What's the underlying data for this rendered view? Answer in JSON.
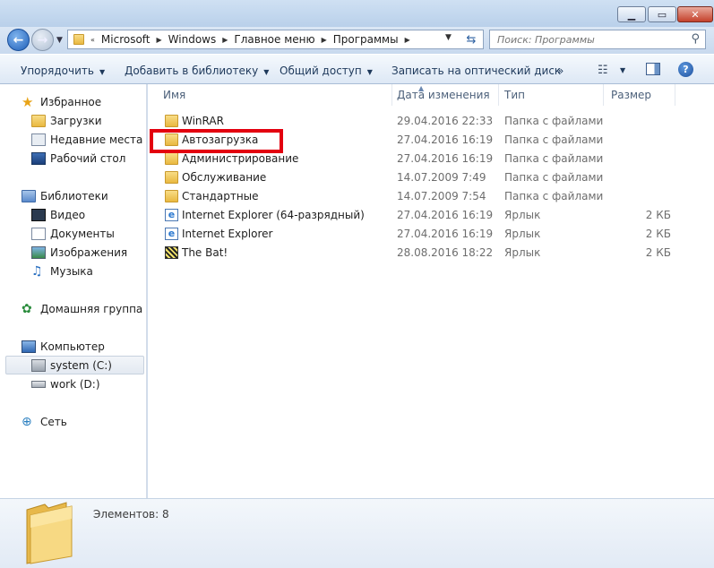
{
  "window": {
    "min_icon": "minimize-icon",
    "max_icon": "maximize-icon",
    "close_icon": "close-icon"
  },
  "nav": {
    "breadcrumb_overflow": "«",
    "breadcrumb": [
      "Microsoft",
      "Windows",
      "Главное меню",
      "Программы"
    ],
    "search_placeholder": "Поиск: Программы"
  },
  "toolbar": {
    "organize": "Упорядочить",
    "add_library": "Добавить в библиотеку",
    "share": "Общий доступ",
    "burn": "Записать на оптический диск",
    "more": "»"
  },
  "sidebar": {
    "favorites": "Избранное",
    "downloads": "Загрузки",
    "recent": "Недавние места",
    "desktop": "Рабочий стол",
    "libraries": "Библиотеки",
    "video": "Видео",
    "documents": "Документы",
    "images": "Изображения",
    "music": "Музыка",
    "homegroup": "Домашняя группа",
    "computer": "Компьютер",
    "drive_c": "system (C:)",
    "drive_d": "work (D:)",
    "network": "Сеть"
  },
  "columns": {
    "name": "Имя",
    "date": "Дата изменения",
    "type": "Тип",
    "size": "Размер"
  },
  "files": [
    {
      "name": "WinRAR",
      "date": "29.04.2016 22:33",
      "type": "Папка с файлами",
      "size": "",
      "icon": "folder-icon"
    },
    {
      "name": "Автозагрузка",
      "date": "27.04.2016 16:19",
      "type": "Папка с файлами",
      "size": "",
      "icon": "folder-icon"
    },
    {
      "name": "Администрирование",
      "date": "27.04.2016 16:19",
      "type": "Папка с файлами",
      "size": "",
      "icon": "folder-icon"
    },
    {
      "name": "Обслуживание",
      "date": "14.07.2009 7:49",
      "type": "Папка с файлами",
      "size": "",
      "icon": "folder-icon"
    },
    {
      "name": "Стандартные",
      "date": "14.07.2009 7:54",
      "type": "Папка с файлами",
      "size": "",
      "icon": "folder-icon"
    },
    {
      "name": "Internet Explorer (64-разрядный)",
      "date": "27.04.2016 16:19",
      "type": "Ярлык",
      "size": "2 КБ",
      "icon": "internet-explorer-shortcut-icon"
    },
    {
      "name": "Internet Explorer",
      "date": "27.04.2016 16:19",
      "type": "Ярлык",
      "size": "2 КБ",
      "icon": "internet-explorer-shortcut-icon"
    },
    {
      "name": "The Bat!",
      "date": "28.08.2016 18:22",
      "type": "Ярлык",
      "size": "2 КБ",
      "icon": "the-bat-shortcut-icon"
    }
  ],
  "details": {
    "count": "Элементов: 8"
  },
  "colors": {
    "highlight": "#e3000f",
    "toolbar_text": "#1e395b"
  }
}
